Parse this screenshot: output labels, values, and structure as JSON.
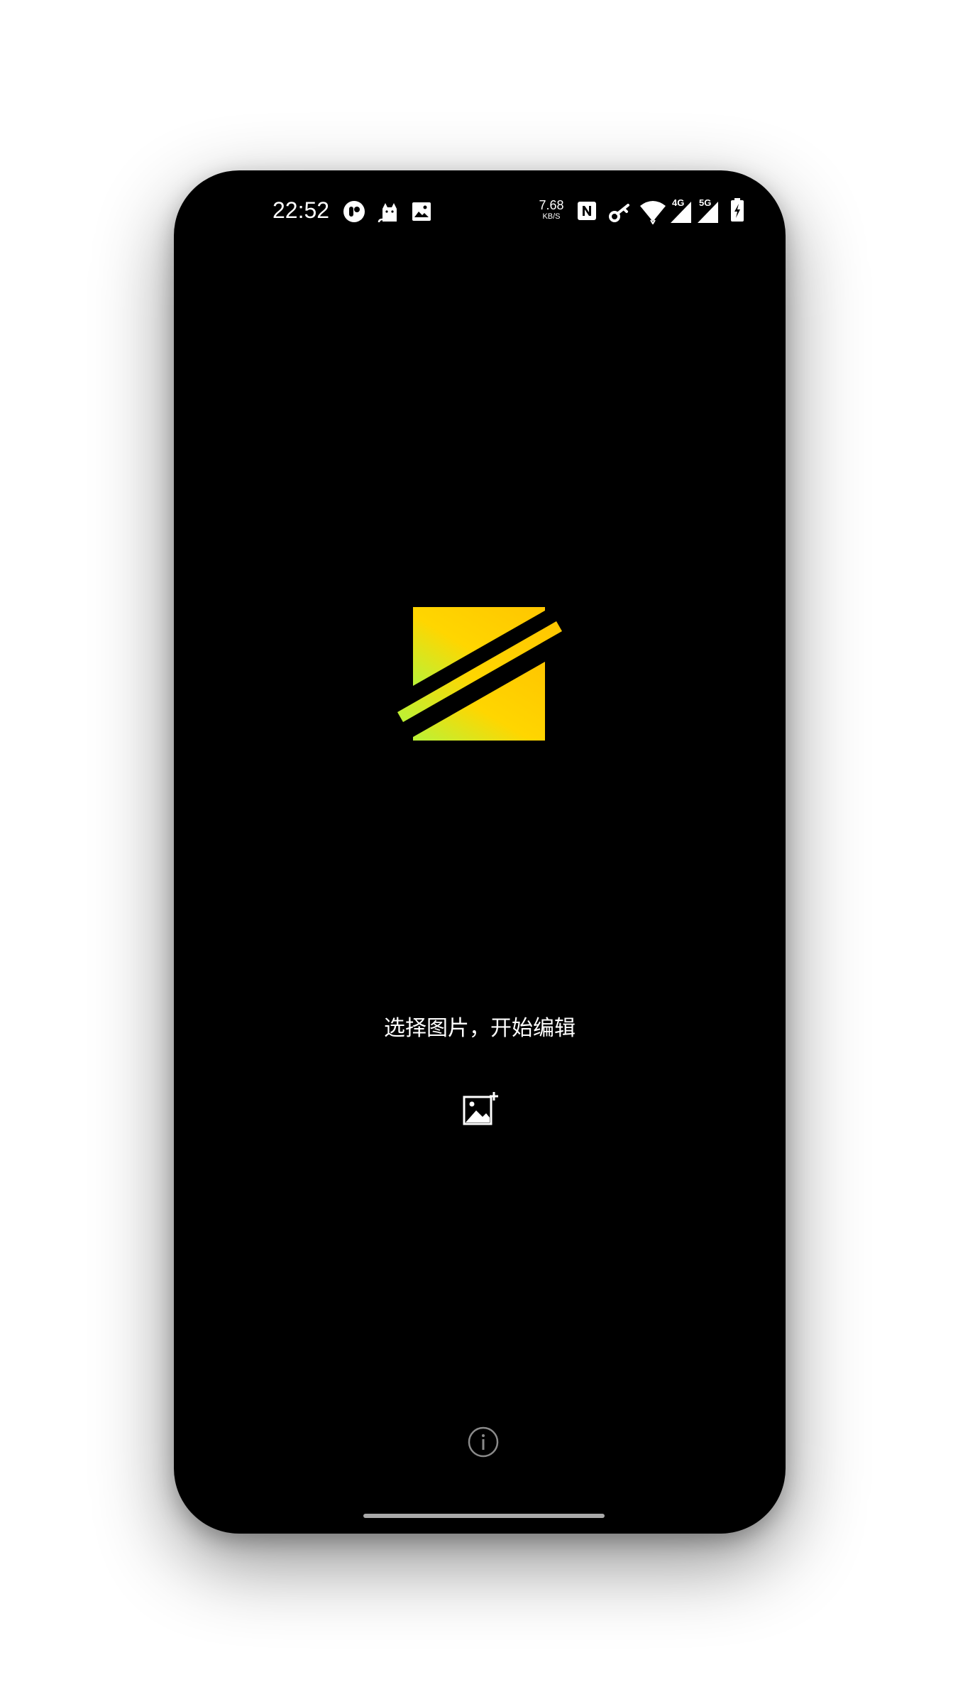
{
  "status_bar": {
    "time": "22:52",
    "net_speed_value": "7.68",
    "net_speed_unit": "KB/S",
    "mobile_net_1": "4G",
    "mobile_net_2": "5G",
    "left_icons": [
      "app-circle-icon",
      "cat-icon",
      "image-icon"
    ],
    "right_icons": [
      "nfc-icon",
      "key-icon",
      "wifi-icon",
      "signal-4g-icon",
      "signal-5g-icon",
      "battery-charging-icon"
    ]
  },
  "main": {
    "logo": "app-logo-icon",
    "prompt": "选择图片，开始编辑",
    "add_image_icon": "add-image-icon",
    "info_icon": "info-icon"
  },
  "colors": {
    "background": "#000000",
    "logo_gradient_start": "#b9f338",
    "logo_gradient_end": "#ffc600",
    "text": "#ffffff",
    "muted_icon": "#8a8a8a"
  }
}
